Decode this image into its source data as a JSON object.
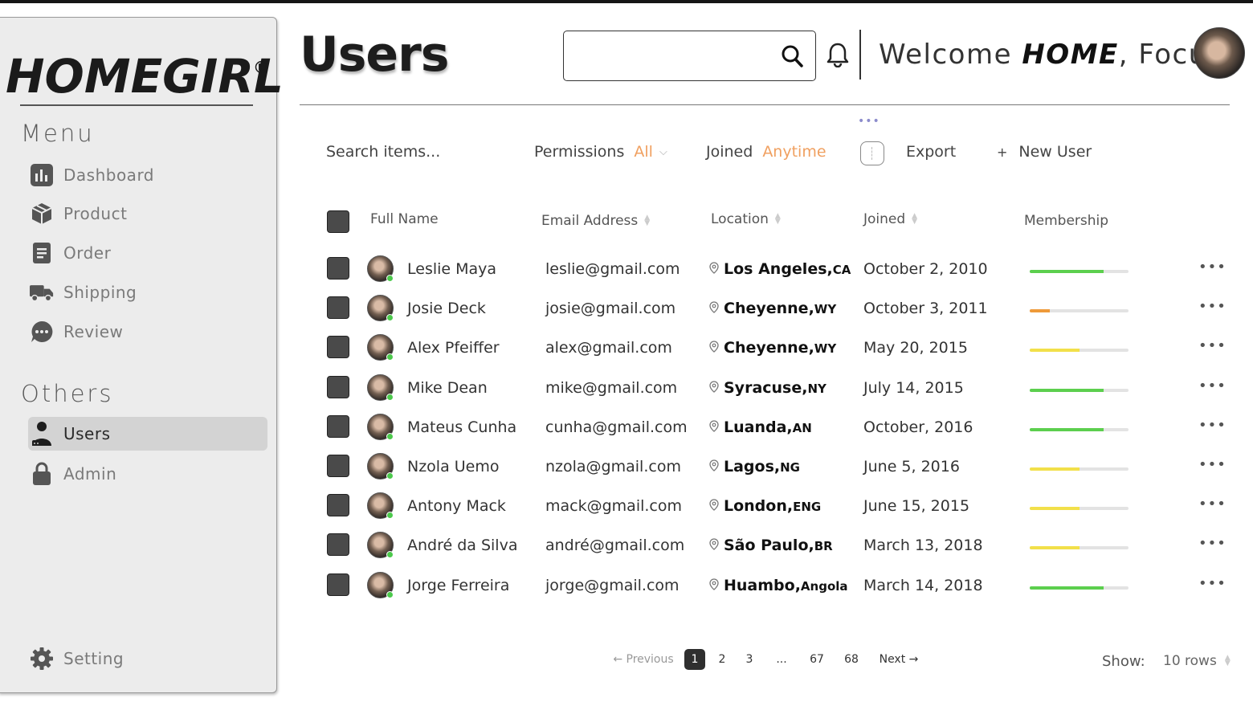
{
  "brand": {
    "logo": "HOMEGIRL",
    "reg_mark": "®"
  },
  "sidebar": {
    "menu_title": "Menu",
    "menu_items": [
      {
        "label": "Dashboard",
        "icon": "bar-chart-icon"
      },
      {
        "label": "Product",
        "icon": "box-icon"
      },
      {
        "label": "Order",
        "icon": "document-icon"
      },
      {
        "label": "Shipping",
        "icon": "truck-icon"
      },
      {
        "label": "Review",
        "icon": "chat-bubble-icon"
      }
    ],
    "others_title": "Others",
    "others_items": [
      {
        "label": "Users",
        "icon": "user-icon",
        "active": true
      },
      {
        "label": "Admin",
        "icon": "lock-icon"
      }
    ],
    "setting_label": "Setting"
  },
  "header": {
    "title": "Users",
    "search_value": "",
    "welcome_prefix": "Welcome ",
    "welcome_bold": "HOME",
    "welcome_suffix": ", Focus"
  },
  "toolbar": {
    "search_placeholder": "Search items...",
    "permissions_label": "Permissions",
    "permissions_value": "All",
    "joined_label": "Joined",
    "joined_value": "Anytime",
    "export_label": "Export",
    "new_user_plus": "+",
    "new_user_label": "New User",
    "accent_color": "#f0a060"
  },
  "table": {
    "columns": [
      "Full Name",
      "Email Address",
      "Location",
      "Joined",
      "Membership"
    ],
    "rows": [
      {
        "name": "Leslie Maya",
        "email": "leslie@gmail.com",
        "city": "Los Angeles,",
        "region": "CA",
        "joined": "October 2, 2010",
        "membership": 0.75,
        "color": "#5ccf4e"
      },
      {
        "name": "Josie Deck",
        "email": "josie@gmail.com",
        "city": "Cheyenne,",
        "region": "WY",
        "joined": "October 3, 2011",
        "membership": 0.2,
        "color": "#ee9a3a"
      },
      {
        "name": "Alex Pfeiffer",
        "email": "alex@gmail.com",
        "city": "Cheyenne,",
        "region": "WY",
        "joined": "May 20, 2015",
        "membership": 0.5,
        "color": "#f2e04a"
      },
      {
        "name": "Mike Dean",
        "email": "mike@gmail.com",
        "city": "Syracuse,",
        "region": "NY",
        "joined": "July 14, 2015",
        "membership": 0.75,
        "color": "#5ccf4e"
      },
      {
        "name": "Mateus Cunha",
        "email": "cunha@gmail.com",
        "city": "Luanda,",
        "region": "AN",
        "joined": "October, 2016",
        "membership": 0.75,
        "color": "#5ccf4e"
      },
      {
        "name": "Nzola Uemo",
        "email": "nzola@gmail.com",
        "city": "Lagos,",
        "region": "NG",
        "joined": "June 5, 2016",
        "membership": 0.5,
        "color": "#f2e04a"
      },
      {
        "name": "Antony Mack",
        "email": "mack@gmail.com",
        "city": "London,",
        "region": "ENG",
        "joined": "June 15, 2015",
        "membership": 0.5,
        "color": "#f2e04a"
      },
      {
        "name": "André da Silva",
        "email": "andré@gmail.com",
        "city": "São Paulo,",
        "region": "BR",
        "joined": "March 13, 2018",
        "membership": 0.5,
        "color": "#f2e04a"
      },
      {
        "name": "Jorge Ferreira",
        "email": "jorge@gmail.com",
        "city": "Huambo,",
        "region": "Angola",
        "joined": "March 14, 2018",
        "membership": 0.75,
        "color": "#5ccf4e"
      }
    ],
    "more_label": "•••"
  },
  "pagination": {
    "previous": "Previous",
    "pages": [
      "1",
      "2",
      "3",
      "...",
      "67",
      "68"
    ],
    "current": "1",
    "next": "Next",
    "show_label": "Show:",
    "show_value": "10 rows"
  }
}
